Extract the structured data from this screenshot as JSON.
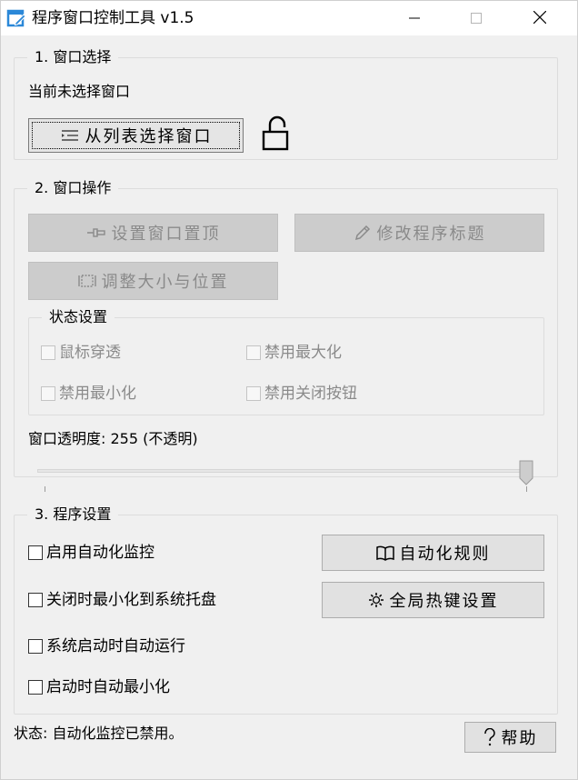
{
  "window": {
    "title": "程序窗口控制工具 v1.5",
    "icon": "app-window-pen-icon",
    "controls": [
      "minimize-icon",
      "maximize-icon",
      "close-icon"
    ]
  },
  "section1": {
    "legend": "1. 窗口选择",
    "current_window_text": "当前未选择窗口",
    "select_button": "从列表选择窗口",
    "select_button_icon": "list-icon",
    "lock_icon": "unlocked-padlock-icon"
  },
  "section2": {
    "legend": "2. 窗口操作",
    "pin_button": "设置窗口置顶",
    "pin_icon": "pin-icon",
    "rename_button": "修改程序标题",
    "rename_icon": "pencil-icon",
    "resize_button": "调整大小与位置",
    "resize_icon": "resize-frame-icon",
    "state_group": {
      "legend": "状态设置",
      "checkboxes": [
        {
          "label": "鼠标穿透",
          "checked": false,
          "enabled": false
        },
        {
          "label": "禁用最大化",
          "checked": false,
          "enabled": false
        },
        {
          "label": "禁用最小化",
          "checked": false,
          "enabled": false
        },
        {
          "label": "禁用关闭按钮",
          "checked": false,
          "enabled": false
        }
      ]
    },
    "opacity_label": "窗口透明度: 255 (不透明)",
    "opacity_value": 255,
    "opacity_max": 255
  },
  "section3": {
    "legend": "3. 程序设置",
    "checkboxes": [
      {
        "label": "启用自动化监控",
        "checked": false
      },
      {
        "label": "关闭时最小化到系统托盘",
        "checked": false
      },
      {
        "label": "系统启动时自动运行",
        "checked": false
      },
      {
        "label": "启动时自动最小化",
        "checked": false
      }
    ],
    "rules_button": "自动化规则",
    "rules_icon": "book-icon",
    "hotkey_button": "全局热键设置",
    "hotkey_icon": "gear-icon"
  },
  "status": {
    "text": "状态: 自动化监控已禁用。"
  },
  "help_button": "帮助",
  "help_icon": "question-mark-icon",
  "colors": {
    "window_bg": "#f0f0f0",
    "button_bg": "#e1e1e1",
    "disabled_bg": "#cccccc",
    "disabled_text": "#8a8a8a",
    "icon_blue": "#2b88d8"
  }
}
